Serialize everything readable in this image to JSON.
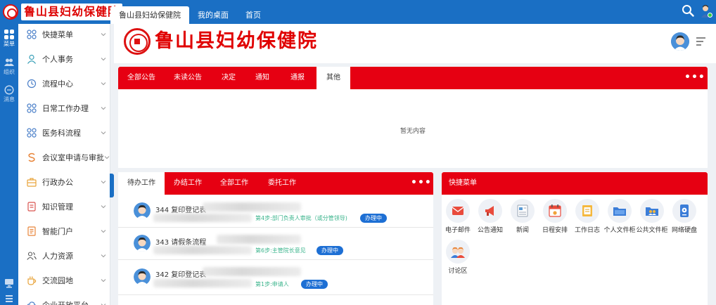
{
  "app": {
    "logo_text": "鲁山县妇幼保健院",
    "tabs": [
      {
        "label": "鲁山县妇幼保健院",
        "active": true
      },
      {
        "label": "我的桌面",
        "active": false
      },
      {
        "label": "首页",
        "active": false
      }
    ],
    "brand_color": "#1a6fc4",
    "accent_color": "#e60012"
  },
  "rail": {
    "items": [
      {
        "label": "菜单",
        "icon": "grid-icon"
      },
      {
        "label": "组织",
        "icon": "users-icon"
      },
      {
        "label": "消息",
        "icon": "chat-icon"
      }
    ],
    "bottom_icons": [
      "monitor-icon",
      "list-icon"
    ]
  },
  "menu": {
    "items": [
      {
        "label": "快捷菜单",
        "icon": "apps-icon"
      },
      {
        "label": "个人事务",
        "icon": "person-icon"
      },
      {
        "label": "流程中心",
        "icon": "process-icon"
      },
      {
        "label": "日常工作办理",
        "icon": "apps-icon"
      },
      {
        "label": "医务科流程",
        "icon": "apps-icon"
      },
      {
        "label": "会议室申请与审批",
        "icon": "s-icon"
      },
      {
        "label": "行政办公",
        "icon": "briefcase-icon"
      },
      {
        "label": "知识管理",
        "icon": "book-icon"
      },
      {
        "label": "智能门户",
        "icon": "doc-icon"
      },
      {
        "label": "人力资源",
        "icon": "people-icon"
      },
      {
        "label": "交流园地",
        "icon": "cup-icon"
      },
      {
        "label": "企业开放平台",
        "icon": "cloud-icon"
      }
    ]
  },
  "header": {
    "brand_text": "鲁山县妇幼保健院"
  },
  "notice": {
    "tabs": [
      "全部公告",
      "未读公告",
      "决定",
      "通知",
      "通报",
      "其他"
    ],
    "active_tab": 5,
    "more": "•••",
    "empty_text": "暂无内容"
  },
  "work": {
    "tabs": [
      "待办工作",
      "办结工作",
      "全部工作",
      "委托工作"
    ],
    "active_tab": 0,
    "more": "•••",
    "rows": [
      {
        "title": "344  复印登记表",
        "step": "第4步:部门负责人审批（或分管领导)",
        "badge": "办理中"
      },
      {
        "title": "343  请假条流程",
        "step": "第6步:主管院长意见",
        "badge": "办理中"
      },
      {
        "title": "342  复印登记表",
        "step": "第1步:申请人",
        "badge": "办理中"
      }
    ]
  },
  "quick": {
    "title": "快捷菜单",
    "items": [
      {
        "label": "电子邮件",
        "icon": "mail-icon"
      },
      {
        "label": "公告通知",
        "icon": "megaphone-icon"
      },
      {
        "label": "新闻",
        "icon": "news-icon"
      },
      {
        "label": "日程安排",
        "icon": "calendar-icon"
      },
      {
        "label": "工作日志",
        "icon": "log-icon"
      },
      {
        "label": "个人文件柜",
        "icon": "folder-icon"
      },
      {
        "label": "公共文件柜",
        "icon": "shared-folder-icon"
      },
      {
        "label": "网络硬盘",
        "icon": "disk-icon"
      },
      {
        "label": "讨论区",
        "icon": "discussion-icon"
      }
    ]
  }
}
